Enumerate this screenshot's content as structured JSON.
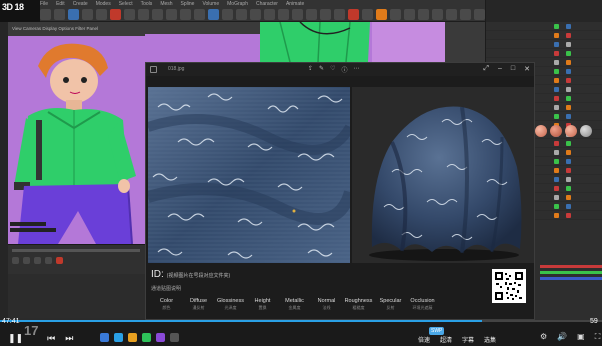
{
  "title_overlay": "3D 18",
  "c4d": {
    "menu": [
      "File",
      "Edit",
      "Create",
      "Modes",
      "Select",
      "Tools",
      "Mesh",
      "Spline",
      "Volume",
      "MoGraph",
      "Character",
      "Animate",
      "Simulate",
      "Tracker",
      "Render",
      "Extensions",
      "Window",
      "Help"
    ],
    "viewport_tabs": "View  Cameras  Display  Options  Filter  Panel",
    "materials": [
      "Mat",
      "Mat",
      "Mat",
      "Mat"
    ]
  },
  "viewer": {
    "file_name": "018.jpg",
    "toolbar_icons": [
      "share-icon",
      "edit-icon",
      "favorite-icon",
      "info-icon",
      "more-icon"
    ],
    "window_controls": [
      "expand-icon",
      "minimize-icon",
      "maximize-icon",
      "close-icon"
    ],
    "id_label": "ID:",
    "id_value": "(视频图片在号段对应文件夹)",
    "maps_label": "通道贴图说明",
    "maps": [
      {
        "en": "Color",
        "cn": "颜色"
      },
      {
        "en": "Diffuse",
        "cn": "漫反射"
      },
      {
        "en": "Glossiness",
        "cn": "光泽度"
      },
      {
        "en": "Height",
        "cn": "置换"
      },
      {
        "en": "Metallic",
        "cn": "金属度"
      },
      {
        "en": "Normal",
        "cn": "法线"
      },
      {
        "en": "Roughness",
        "cn": "粗糙度"
      },
      {
        "en": "Specular",
        "cn": "反射"
      },
      {
        "en": "Occlusion",
        "cn": "环境光遮蔽"
      }
    ]
  },
  "player": {
    "time_left": "47:41",
    "time_right": "59",
    "big_number": "17",
    "progress": 0.8,
    "buttons": [
      "倍速",
      "超清",
      "字幕",
      "选集"
    ],
    "badge": "SWP"
  },
  "colors": {
    "accent": "#2aa0e6",
    "purple_bg": "#b478d8",
    "fabric_blue": "#3d5576"
  }
}
